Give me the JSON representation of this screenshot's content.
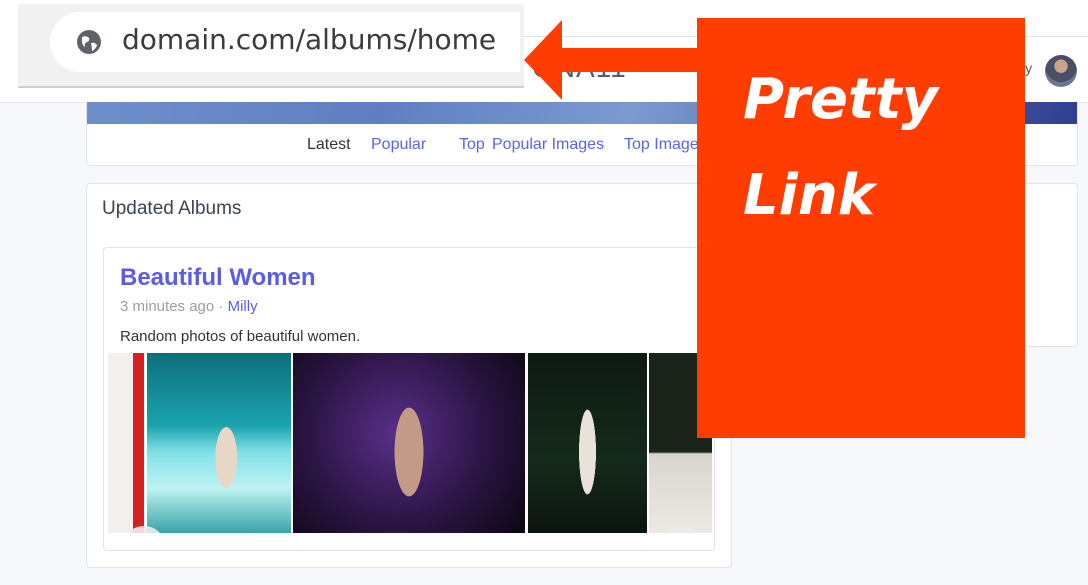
{
  "browser": {
    "url": "domain.com/albums/home"
  },
  "navbar": {
    "brand": "GNA11",
    "user_name": "ly"
  },
  "tabs": [
    {
      "label": "Latest",
      "active": true
    },
    {
      "label": "Popular"
    },
    {
      "label": "Top"
    },
    {
      "label": "Popular Images"
    },
    {
      "label": "Top Images"
    }
  ],
  "albums": {
    "heading": "Updated Albums",
    "item": {
      "title": "Beautiful Women",
      "time": "3 minutes ago",
      "separator": "·",
      "author": "Milly",
      "description": "Random photos of beautiful women."
    }
  },
  "annotation": {
    "text": "Pretty\nLink",
    "color": "#ff3d00"
  },
  "icons": {
    "globe": "globe-icon",
    "prev": "chevron-left-icon",
    "next": "chevron-right-icon",
    "arrow": "arrow-left-icon"
  }
}
